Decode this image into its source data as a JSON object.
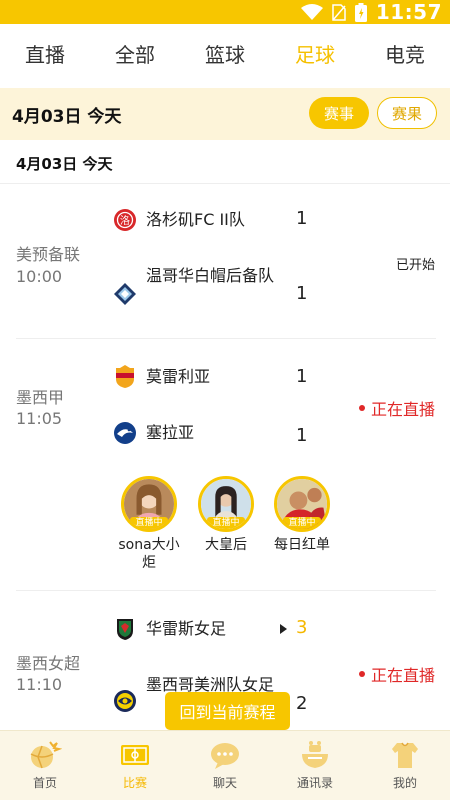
{
  "status_bar": {
    "time": "11:57"
  },
  "tabs": [
    {
      "label": "直播",
      "active": false
    },
    {
      "label": "全部",
      "active": false
    },
    {
      "label": "篮球",
      "active": false
    },
    {
      "label": "足球",
      "active": true
    },
    {
      "label": "电竞",
      "active": false
    }
  ],
  "date_bar": {
    "text": "4月03日  今天",
    "btn_events": "赛事",
    "btn_results": "赛果"
  },
  "day_header": {
    "text": "4月03日    今天"
  },
  "matches": [
    {
      "league": "美预备联",
      "time": "10:00",
      "home": {
        "name": "洛杉矶FC II队",
        "score": "1"
      },
      "away": {
        "name": "温哥华白帽后备队",
        "score": "1"
      },
      "status": "已开始"
    },
    {
      "league": "墨西甲",
      "time": "11:05",
      "home": {
        "name": "莫雷利亚",
        "score": "1"
      },
      "away": {
        "name": "塞拉亚",
        "score": "1"
      },
      "status": "正在直播",
      "streamers": [
        {
          "name": "sona大小炬",
          "tag": "直播中"
        },
        {
          "name": "大皇后",
          "tag": "直播中"
        },
        {
          "name": "每日红单",
          "tag": "直播中"
        }
      ]
    },
    {
      "league": "墨西女超",
      "time": "11:10",
      "home": {
        "name": "华雷斯女足",
        "score": "3"
      },
      "away": {
        "name": "墨西哥美洲队女足",
        "score": "2"
      },
      "status": "正在直播"
    }
  ],
  "back_button": "回到当前赛程",
  "bottom_nav": [
    {
      "label": "首页",
      "icon": "home-icon",
      "active": false
    },
    {
      "label": "比赛",
      "icon": "match-icon",
      "active": true
    },
    {
      "label": "聊天",
      "icon": "chat-icon",
      "active": false
    },
    {
      "label": "通讯录",
      "icon": "contacts-icon",
      "active": false
    },
    {
      "label": "我的",
      "icon": "profile-icon",
      "active": false
    }
  ],
  "colors": {
    "accent": "#f7c600",
    "live": "#e02828",
    "date_bg": "#fdf4d9"
  }
}
